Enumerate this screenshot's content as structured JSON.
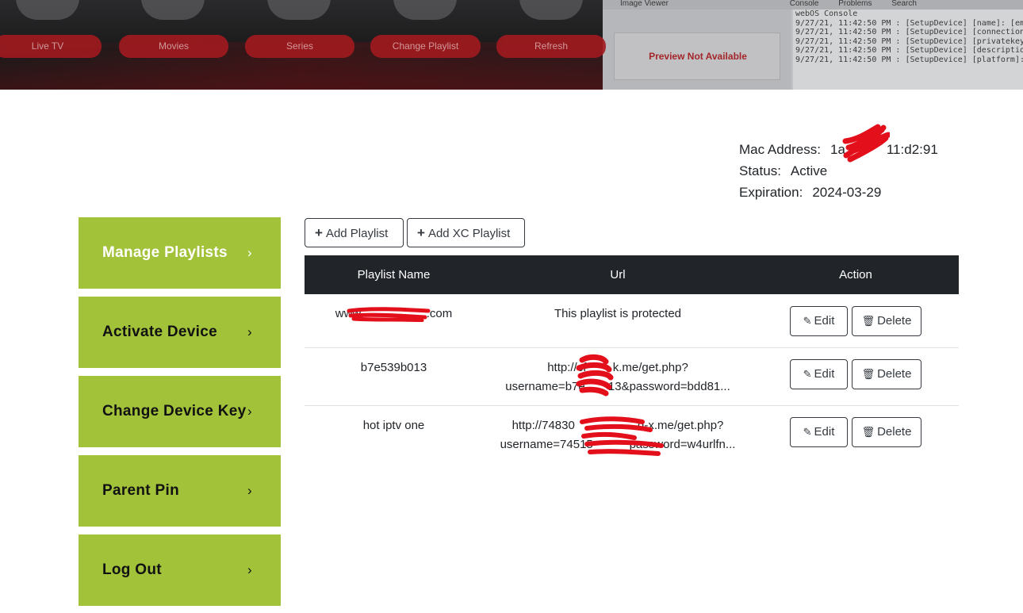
{
  "banner": {
    "tiles": [
      "Live TV",
      "Movies",
      "Series",
      "Change Playlist",
      "Refresh"
    ],
    "ide_tabs": [
      "Image Viewer",
      "Console",
      "Problems",
      "Search"
    ],
    "preview_text": "Preview Not Available",
    "console_title": "webOS Console",
    "console_lines": [
      "9/27/21, 11:42:50 PM : [SetupDevice] [name]: [emulator]",
      "9/27/21, 11:42:50 PM : [SetupDevice] [connection]: [[\"ssh\"",
      "9/27/21, 11:42:50 PM : [SetupDevice] [privatekey]: [webos",
      "9/27/21, 11:42:50 PM : [SetupDevice] [description]: [LG w",
      "9/27/21, 11:42:50 PM : [SetupDevice] [platform]: [starfish"
    ]
  },
  "device": {
    "mac_label": "Mac Address:",
    "mac_value": "1a           11:d2:91",
    "status_label": "Status:",
    "status_value": "Active",
    "expiration_label": "Expiration:",
    "expiration_value": "2024-03-29"
  },
  "sidebar": {
    "items": [
      {
        "label": "Manage Playlists",
        "chevron": "›"
      },
      {
        "label": "Activate Device",
        "chevron": "›"
      },
      {
        "label": "Change Device Key",
        "chevron": "›"
      },
      {
        "label": "Parent Pin",
        "chevron": "›"
      },
      {
        "label": "Log Out",
        "chevron": "›"
      }
    ]
  },
  "toolbar": {
    "add_playlist": "Add Playlist",
    "add_xc_playlist": "Add XC Playlist"
  },
  "table": {
    "headers": [
      "Playlist Name",
      "Url",
      "Action"
    ],
    "rows": [
      {
        "name": "www.                   .com",
        "url_line1": "This playlist is protected",
        "url_line2": ""
      },
      {
        "name": "b7e539b013",
        "url_line1": "http://cf        k.me/get.php?",
        "url_line2": "username=b7e       13&password=bdd81..."
      },
      {
        "name": "hot iptv one",
        "url_line1": "http://74830                   d-x.me/get.php?",
        "url_line2": "username=74515           password=w4urlfn..."
      }
    ],
    "edit_label": "Edit",
    "delete_label": "Delete"
  },
  "colors": {
    "sidebar_bg": "#a2c23a",
    "table_header_bg": "#212529",
    "redaction": "#e3101c"
  }
}
